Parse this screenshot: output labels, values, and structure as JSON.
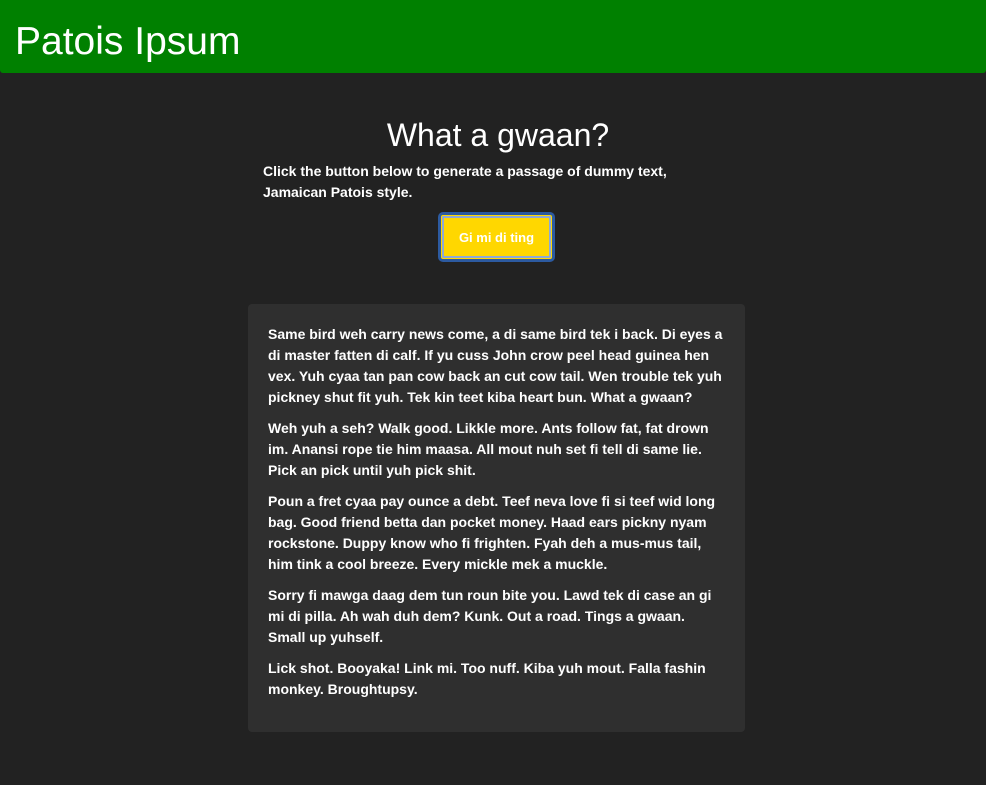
{
  "header": {
    "title": "Patois Ipsum"
  },
  "intro": {
    "heading": "What a gwaan?",
    "description": "Click the button below to generate a passage of dummy text, Jamaican Patois style."
  },
  "generate_button": {
    "label": "Gi mi di ting"
  },
  "passage": {
    "paragraphs": [
      "Same bird weh carry news come, a di same bird tek i back. Di eyes a di master fatten di calf. If yu cuss John crow peel head guinea hen vex. Yuh cyaa tan pan cow back an cut cow tail. Wen trouble tek yuh pickney shut fit yuh. Tek kin teet kiba heart bun. What a gwaan?",
      "Weh yuh a seh? Walk good. Likkle more. Ants follow fat, fat drown im. Anansi rope tie him maasa. All mout nuh set fi tell di same lie. Pick an pick until yuh pick shit.",
      "Poun a fret cyaa pay ounce a debt. Teef neva love fi si teef wid long bag. Good friend betta dan pocket money. Haad ears pickny nyam rockstone. Duppy know who fi frighten. Fyah deh a mus-mus tail, him tink a cool breeze. Every mickle mek a muckle.",
      "Sorry fi mawga daag dem tun roun bite you. Lawd tek di case an gi mi di pilla. Ah wah duh dem? Kunk. Out a road. Tings a gwaan. Small up yuhself.",
      "Lick shot. Booyaka! Link mi. Too nuff. Kiba yuh mout. Falla fashin monkey. Broughtupsy."
    ]
  },
  "colors": {
    "page_background": "#222222",
    "header_background": "#008000",
    "button_background": "#ffd700",
    "button_border": "#2c5aa0",
    "card_background": "#2f2f2f",
    "text": "#ffffff"
  }
}
